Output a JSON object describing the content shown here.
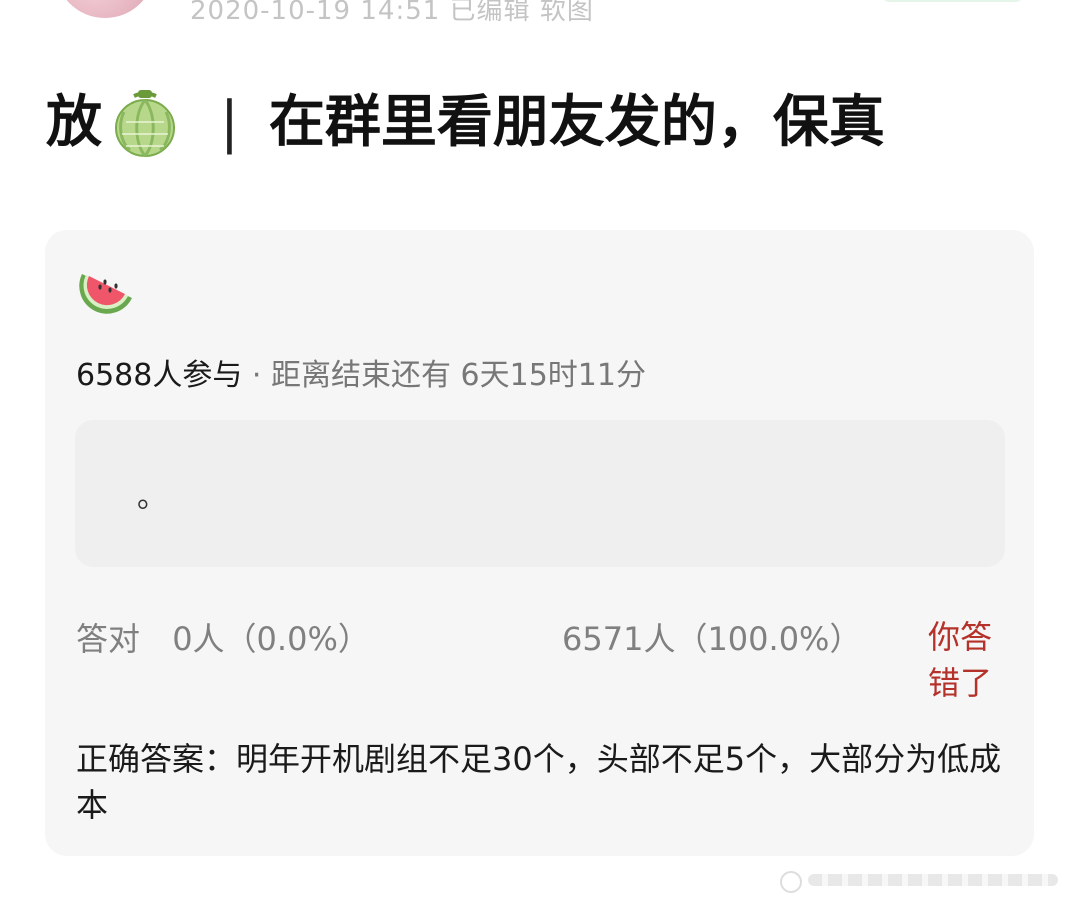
{
  "meta": {
    "timestamp_partial": "2020-10-19 14:51 已编辑 软图"
  },
  "post": {
    "title_prefix": "放",
    "title_icon": "melon-icon",
    "title_divider": "|",
    "title_text": "在群里看朋友发的，保真"
  },
  "quiz": {
    "icon": "watermelon-icon",
    "participants": "6588人参与",
    "separator": "·",
    "time_remaining": "距离结束还有 6天15时11分",
    "question_text": "。",
    "correct_label": "答对",
    "correct_count": "0人（0.0%）",
    "wrong_count": "6571人（100.0%）",
    "result": "你答错了",
    "answer": "正确答案：明年开机剧组不足30个，头部不足5个，大部分为低成本"
  },
  "colors": {
    "card_bg": "#f6f6f6",
    "question_bg": "#efefef",
    "wrong_text": "#b5322a",
    "muted_text": "#808080"
  }
}
